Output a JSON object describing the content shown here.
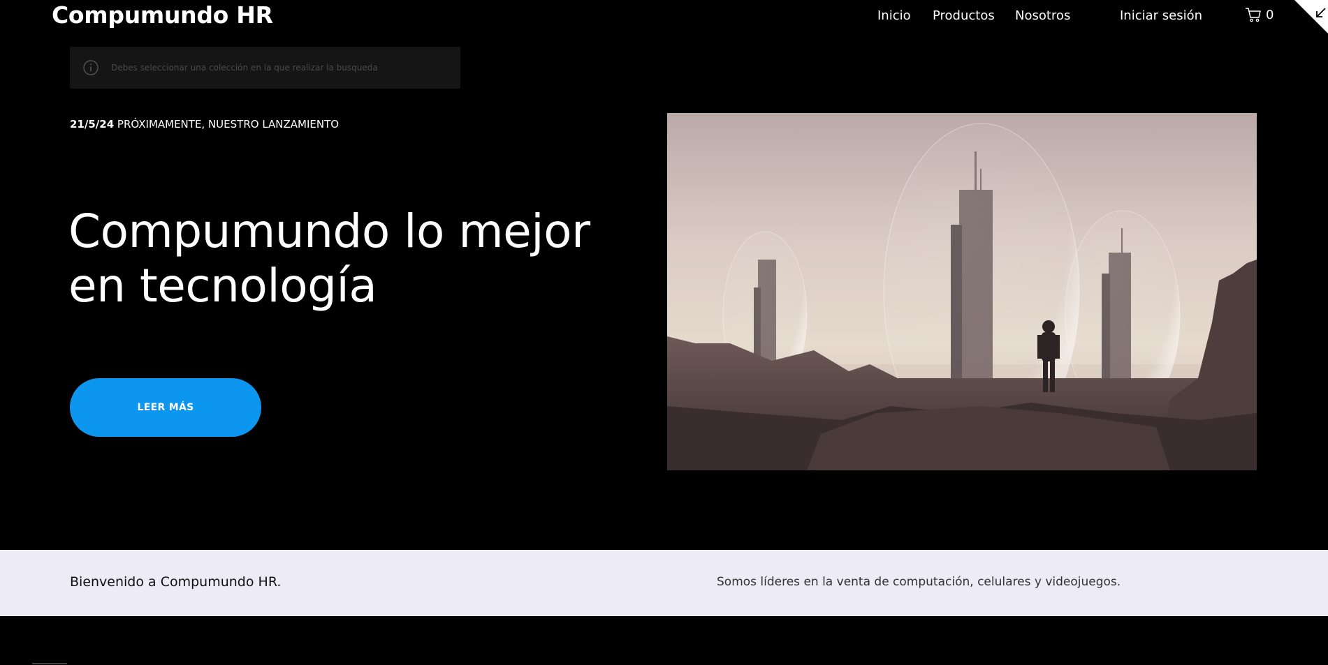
{
  "header": {
    "brand": "Compumundo HR",
    "nav": [
      {
        "label": "Inicio"
      },
      {
        "label": "Productos"
      },
      {
        "label": "Nosotros"
      }
    ],
    "login_label": "Iniciar sesión",
    "cart_count": "0",
    "cart_icon": "cart-icon"
  },
  "notice": {
    "icon": "info-icon",
    "text": "Debes seleccionar una colección en la que realizar la busqueda"
  },
  "hero": {
    "date": "21/5/24",
    "date_caption": " PRÓXIMAMENTE, NUESTRO LANZAMIENTO",
    "headline": "Compumundo lo mejor en tecnología",
    "cta_label": "LEER MÁS"
  },
  "welcome": {
    "title": "Bienvenido a Compumundo HR.",
    "text": "Somos líderes en la venta de computación, celulares y videojuegos."
  },
  "colors": {
    "background": "#000000",
    "accent": "#0c96f0",
    "band": "#ecebf6"
  }
}
